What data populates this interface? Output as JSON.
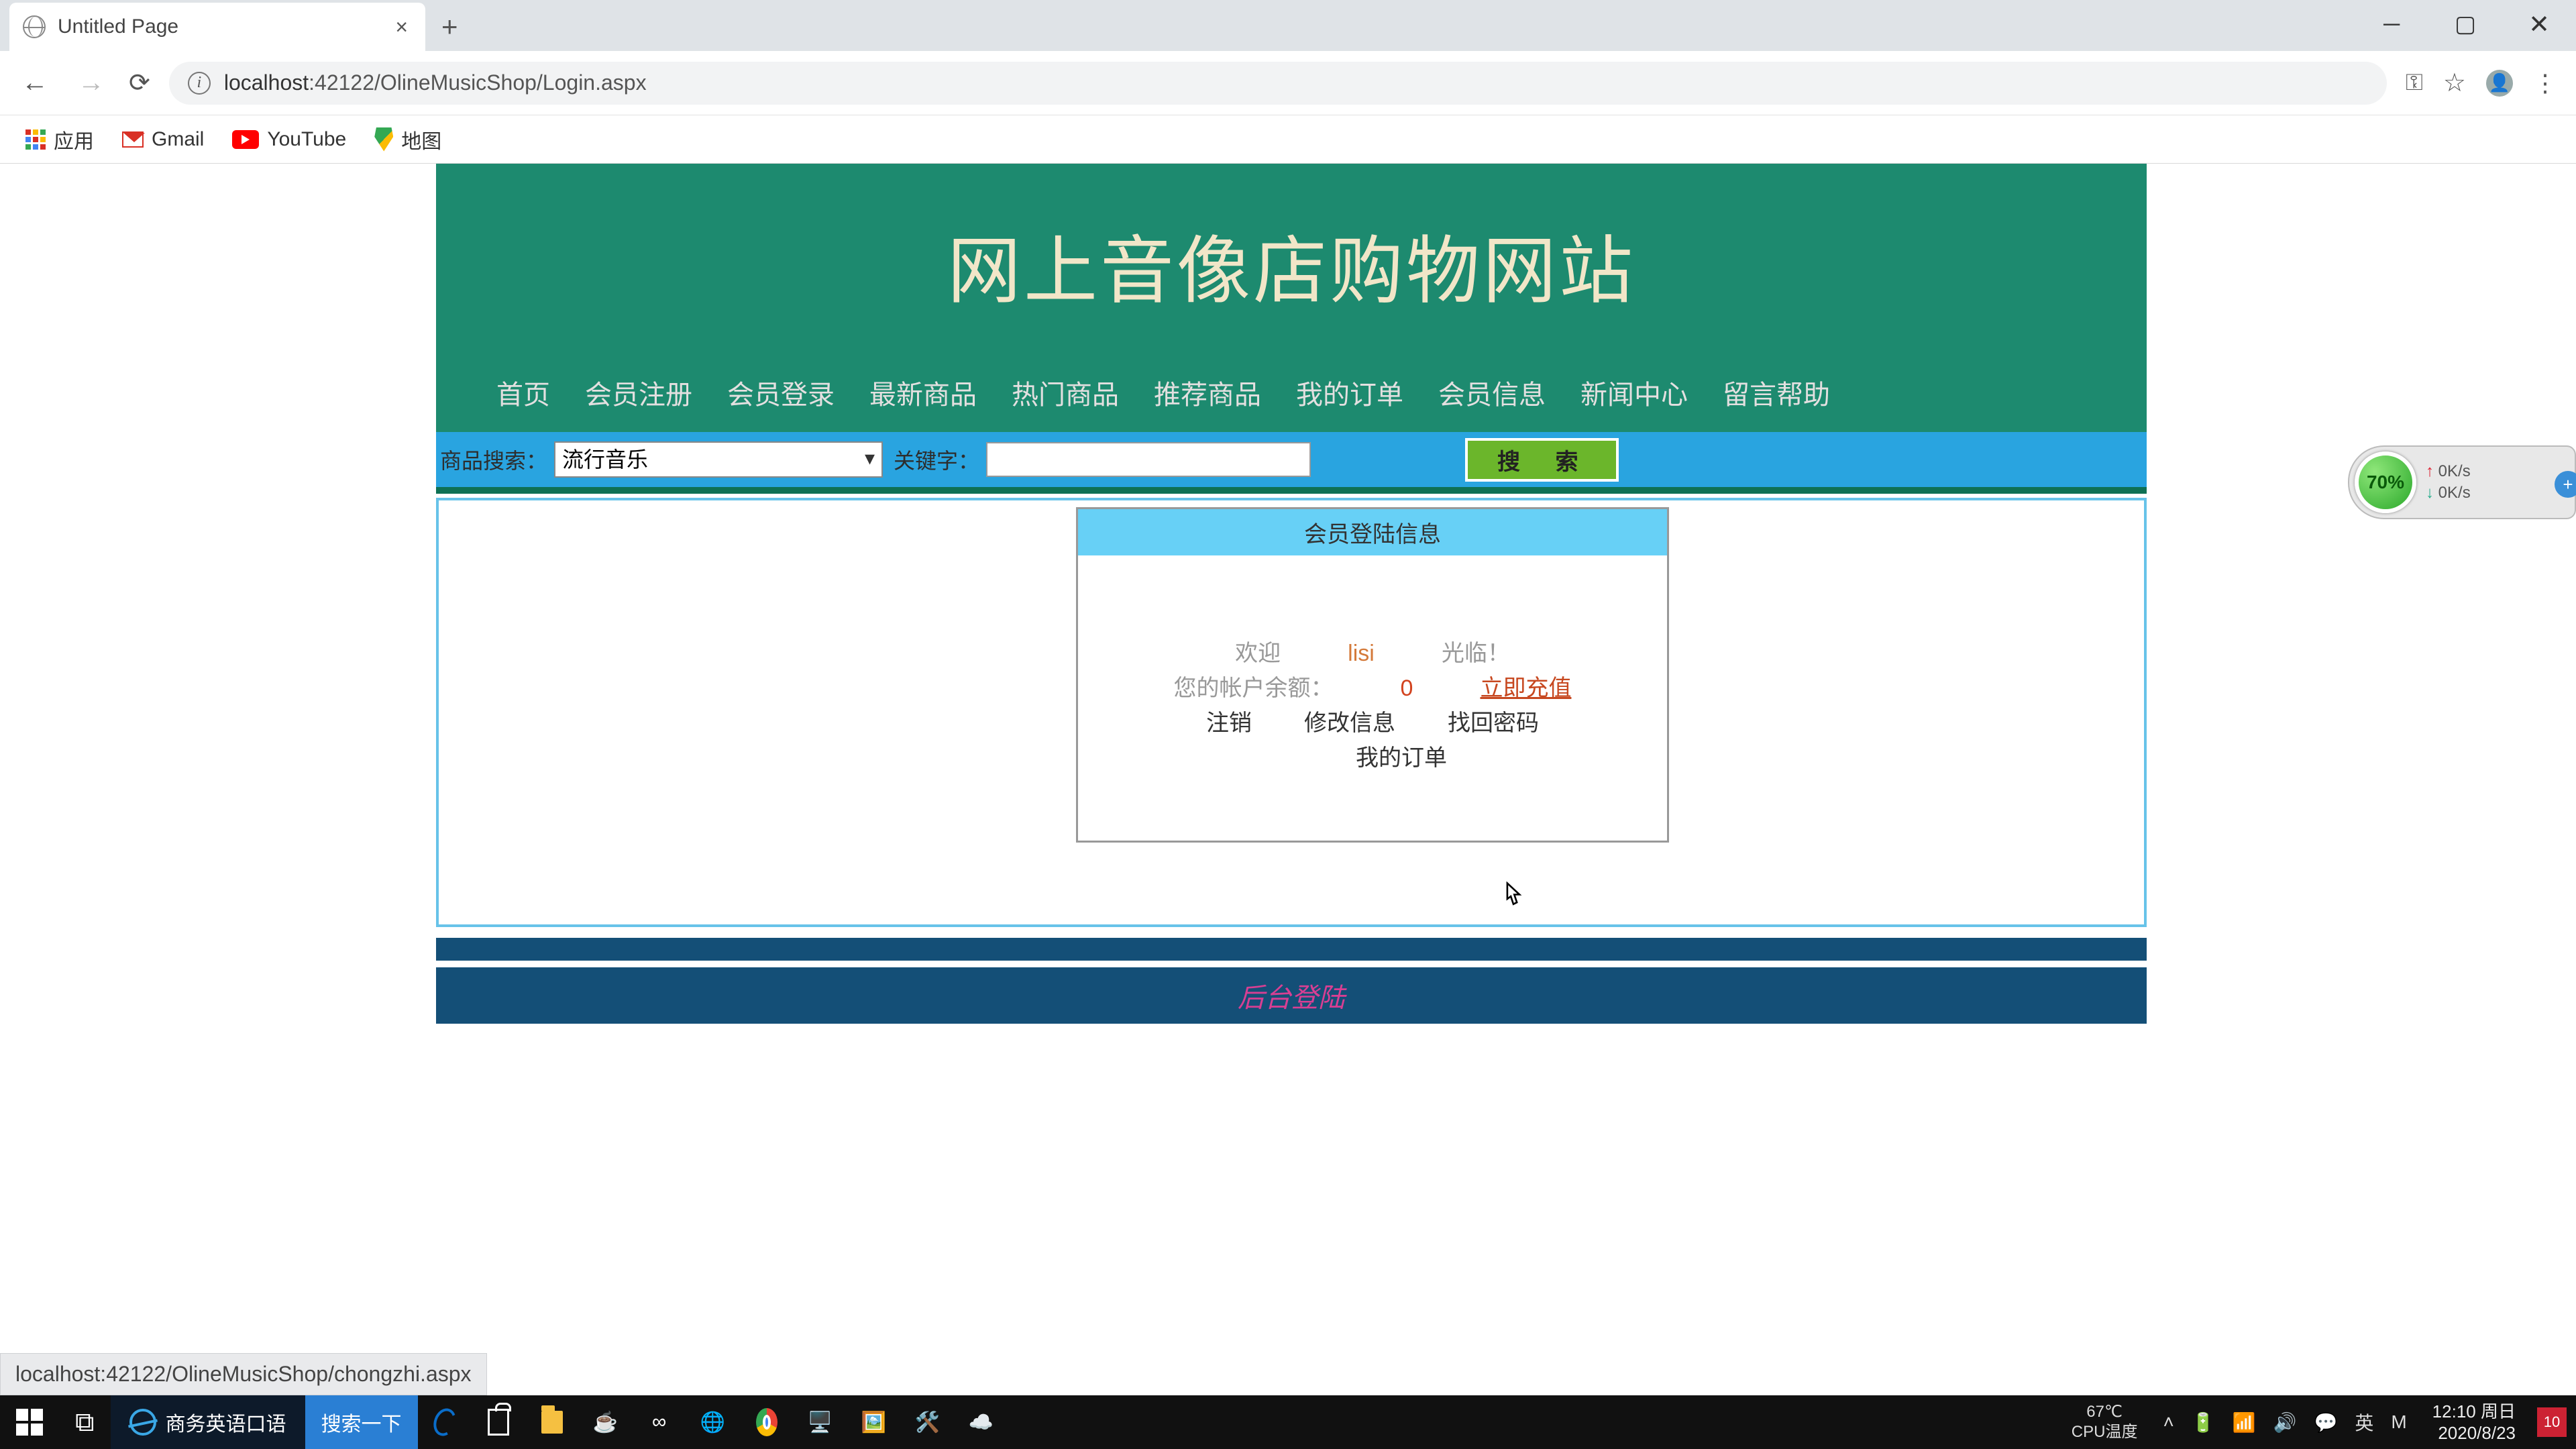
{
  "browser": {
    "tab_title": "Untitled Page",
    "url_display": "localhost:42122/OlineMusicShop/Login.aspx",
    "url_host": "localhost",
    "status_url": "localhost:42122/OlineMusicShop/chongzhi.aspx"
  },
  "bookmarks": {
    "apps": "应用",
    "gmail": "Gmail",
    "youtube": "YouTube",
    "maps": "地图"
  },
  "site": {
    "title": "网上音像店购物网站",
    "nav": [
      "首页",
      "会员注册",
      "会员登录",
      "最新商品",
      "热门商品",
      "推荐商品",
      "我的订单",
      "会员信息",
      "新闻中心",
      "留言帮助"
    ],
    "search": {
      "label": "商品搜索：",
      "category_selected": "流行音乐",
      "keyword_label": "关键字：",
      "keyword_value": "",
      "button": "搜 索"
    }
  },
  "panel": {
    "header": "会员登陆信息",
    "welcome_prefix": "欢迎",
    "username": "lisi",
    "welcome_suffix": "光临！",
    "balance_label": "您的帐户余额：",
    "balance_value": "0",
    "recharge": "立即充值",
    "logout": "注销",
    "edit_info": "修改信息",
    "find_pwd": "找回密码",
    "my_orders": "我的订单"
  },
  "footer": {
    "admin_login": "后台登陆"
  },
  "sysmon": {
    "percent": "70%",
    "up": "0K/s",
    "down": "0K/s"
  },
  "taskbar": {
    "ie_title": "商务英语口语",
    "search": "搜索一下",
    "temp_value": "67℃",
    "temp_label": "CPU温度",
    "ime": "英",
    "time": "12:10",
    "day": "周日",
    "date": "2020/8/23",
    "notif_count": "10"
  }
}
